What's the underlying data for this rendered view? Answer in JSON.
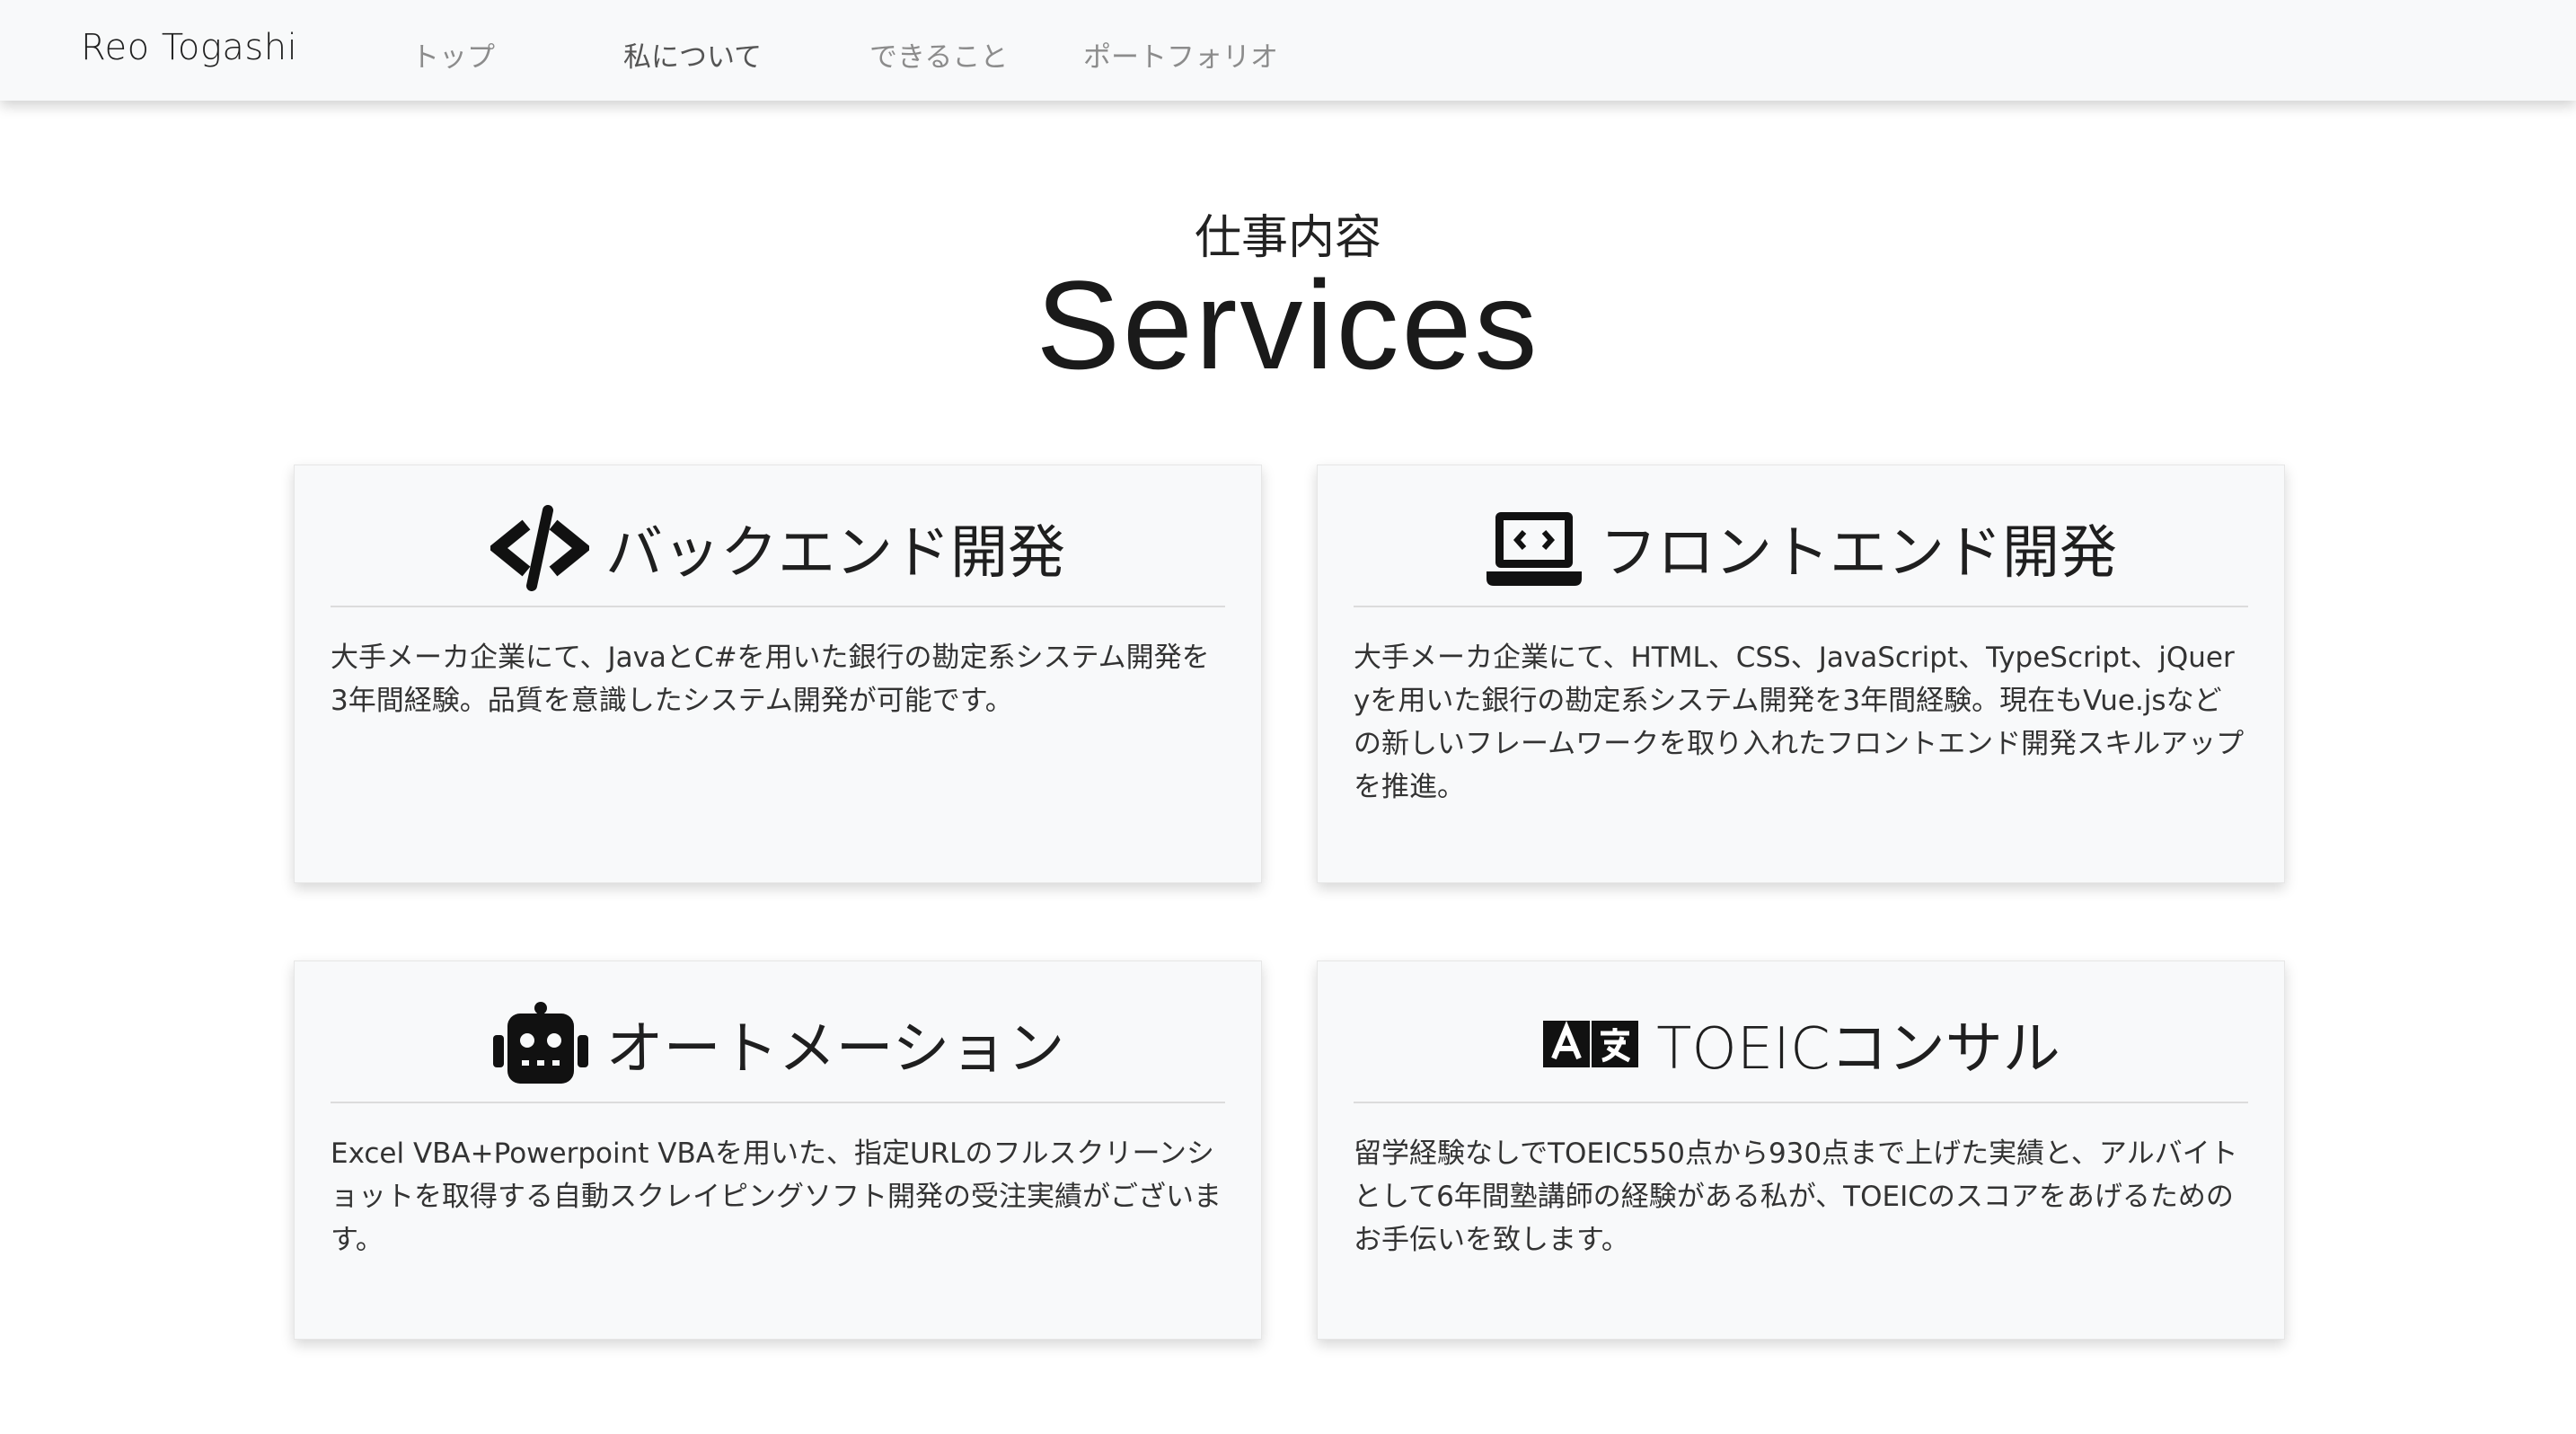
{
  "nav": {
    "brand": "Reo Togashi",
    "links": [
      {
        "label": "トップ"
      },
      {
        "label": "私について"
      },
      {
        "label": "できること"
      },
      {
        "label": "ポートフォリオ"
      }
    ]
  },
  "header": {
    "subtitle": "仕事内容",
    "title": "Services"
  },
  "services": [
    {
      "icon": "code-icon",
      "title": "バックエンド開発",
      "description": "大手メーカ企業にて、JavaとC#を用いた銀行の勘定系システム開発を3年間経験。品質を意識したシステム開発が可能です。"
    },
    {
      "icon": "laptop-code-icon",
      "title": "フロントエンド開発",
      "description": "大手メーカ企業にて、HTML、CSS、JavaScript、TypeScript、jQueryを用いた銀行の勘定系システム開発を3年間経験。現在もVue.jsなどの新しいフレームワークを取り入れたフロントエンド開発スキルアップを推進。"
    },
    {
      "icon": "robot-icon",
      "title": "オートメーション",
      "description": "Excel VBA+Powerpoint VBAを用いた、指定URLのフルスクリーンショットを取得する自動スクレイピングソフト開発の受注実績がございます。"
    },
    {
      "icon": "language-icon",
      "title": "TOEICコンサル",
      "description": "留学経験なしでTOEIC550点から930点まで上げた実績と、アルバイトとして6年間塾講師の経験がある私が、TOEICのスコアをあげるためのお手伝いを致します。"
    }
  ]
}
